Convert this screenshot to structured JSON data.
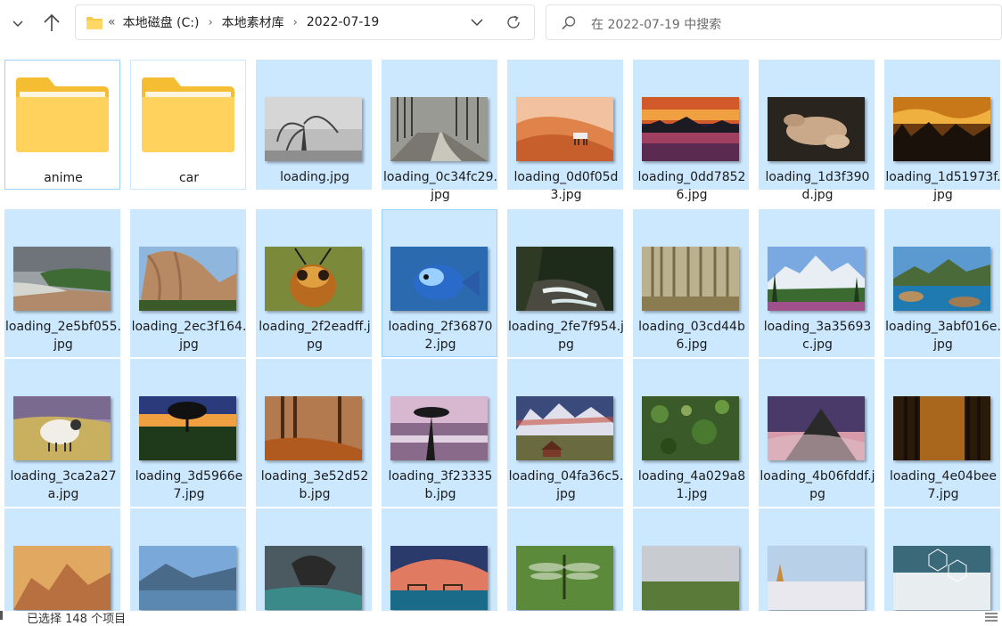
{
  "address": {
    "lead": "«",
    "crumbs": [
      "本地磁盘 (C:)",
      "本地素材库",
      "2022-07-19"
    ]
  },
  "search": {
    "placeholder": "在 2022-07-19 中搜索"
  },
  "items": [
    {
      "label": "anime",
      "kind": "folder"
    },
    {
      "label": "car",
      "kind": "folder"
    },
    {
      "label": "loading.jpg",
      "kind": "image"
    },
    {
      "label": "loading_0c34fc29.jpg",
      "kind": "image"
    },
    {
      "label": "loading_0d0f05d3.jpg",
      "kind": "image"
    },
    {
      "label": "loading_0dd78526.jpg",
      "kind": "image"
    },
    {
      "label": "loading_1d3f390d.jpg",
      "kind": "image"
    },
    {
      "label": "loading_1d51973f.jpg",
      "kind": "image"
    },
    {
      "label": "loading_2e5bf055.jpg",
      "kind": "image"
    },
    {
      "label": "loading_2ec3f164.jpg",
      "kind": "image"
    },
    {
      "label": "loading_2f2eadff.jpg",
      "kind": "image"
    },
    {
      "label": "loading_2f368702.jpg",
      "kind": "image"
    },
    {
      "label": "loading_2fe7f954.jpg",
      "kind": "image"
    },
    {
      "label": "loading_03cd44b6.jpg",
      "kind": "image"
    },
    {
      "label": "loading_3a35693c.jpg",
      "kind": "image"
    },
    {
      "label": "loading_3abf016e.jpg",
      "kind": "image"
    },
    {
      "label": "loading_3ca2a27a.jpg",
      "kind": "image"
    },
    {
      "label": "loading_3d5966e7.jpg",
      "kind": "image"
    },
    {
      "label": "loading_3e52d52b.jpg",
      "kind": "image"
    },
    {
      "label": "loading_3f23335b.jpg",
      "kind": "image"
    },
    {
      "label": "loading_04fa36c5.jpg",
      "kind": "image"
    },
    {
      "label": "loading_4a029a81.jpg",
      "kind": "image"
    },
    {
      "label": "loading_4b06fddf.jpg",
      "kind": "image"
    },
    {
      "label": "loading_4e04bee7.jpg",
      "kind": "image"
    },
    {
      "label": "",
      "kind": "image"
    },
    {
      "label": "",
      "kind": "image"
    },
    {
      "label": "",
      "kind": "image"
    },
    {
      "label": "",
      "kind": "image"
    },
    {
      "label": "",
      "kind": "image"
    },
    {
      "label": "",
      "kind": "image"
    },
    {
      "label": "",
      "kind": "image"
    },
    {
      "label": "",
      "kind": "image"
    }
  ],
  "status": {
    "selection": "已选择 148 个项目"
  },
  "colors": {
    "selection": "#cce8ff",
    "selection_border": "#99d1ff",
    "folder": "#ffd25e"
  }
}
